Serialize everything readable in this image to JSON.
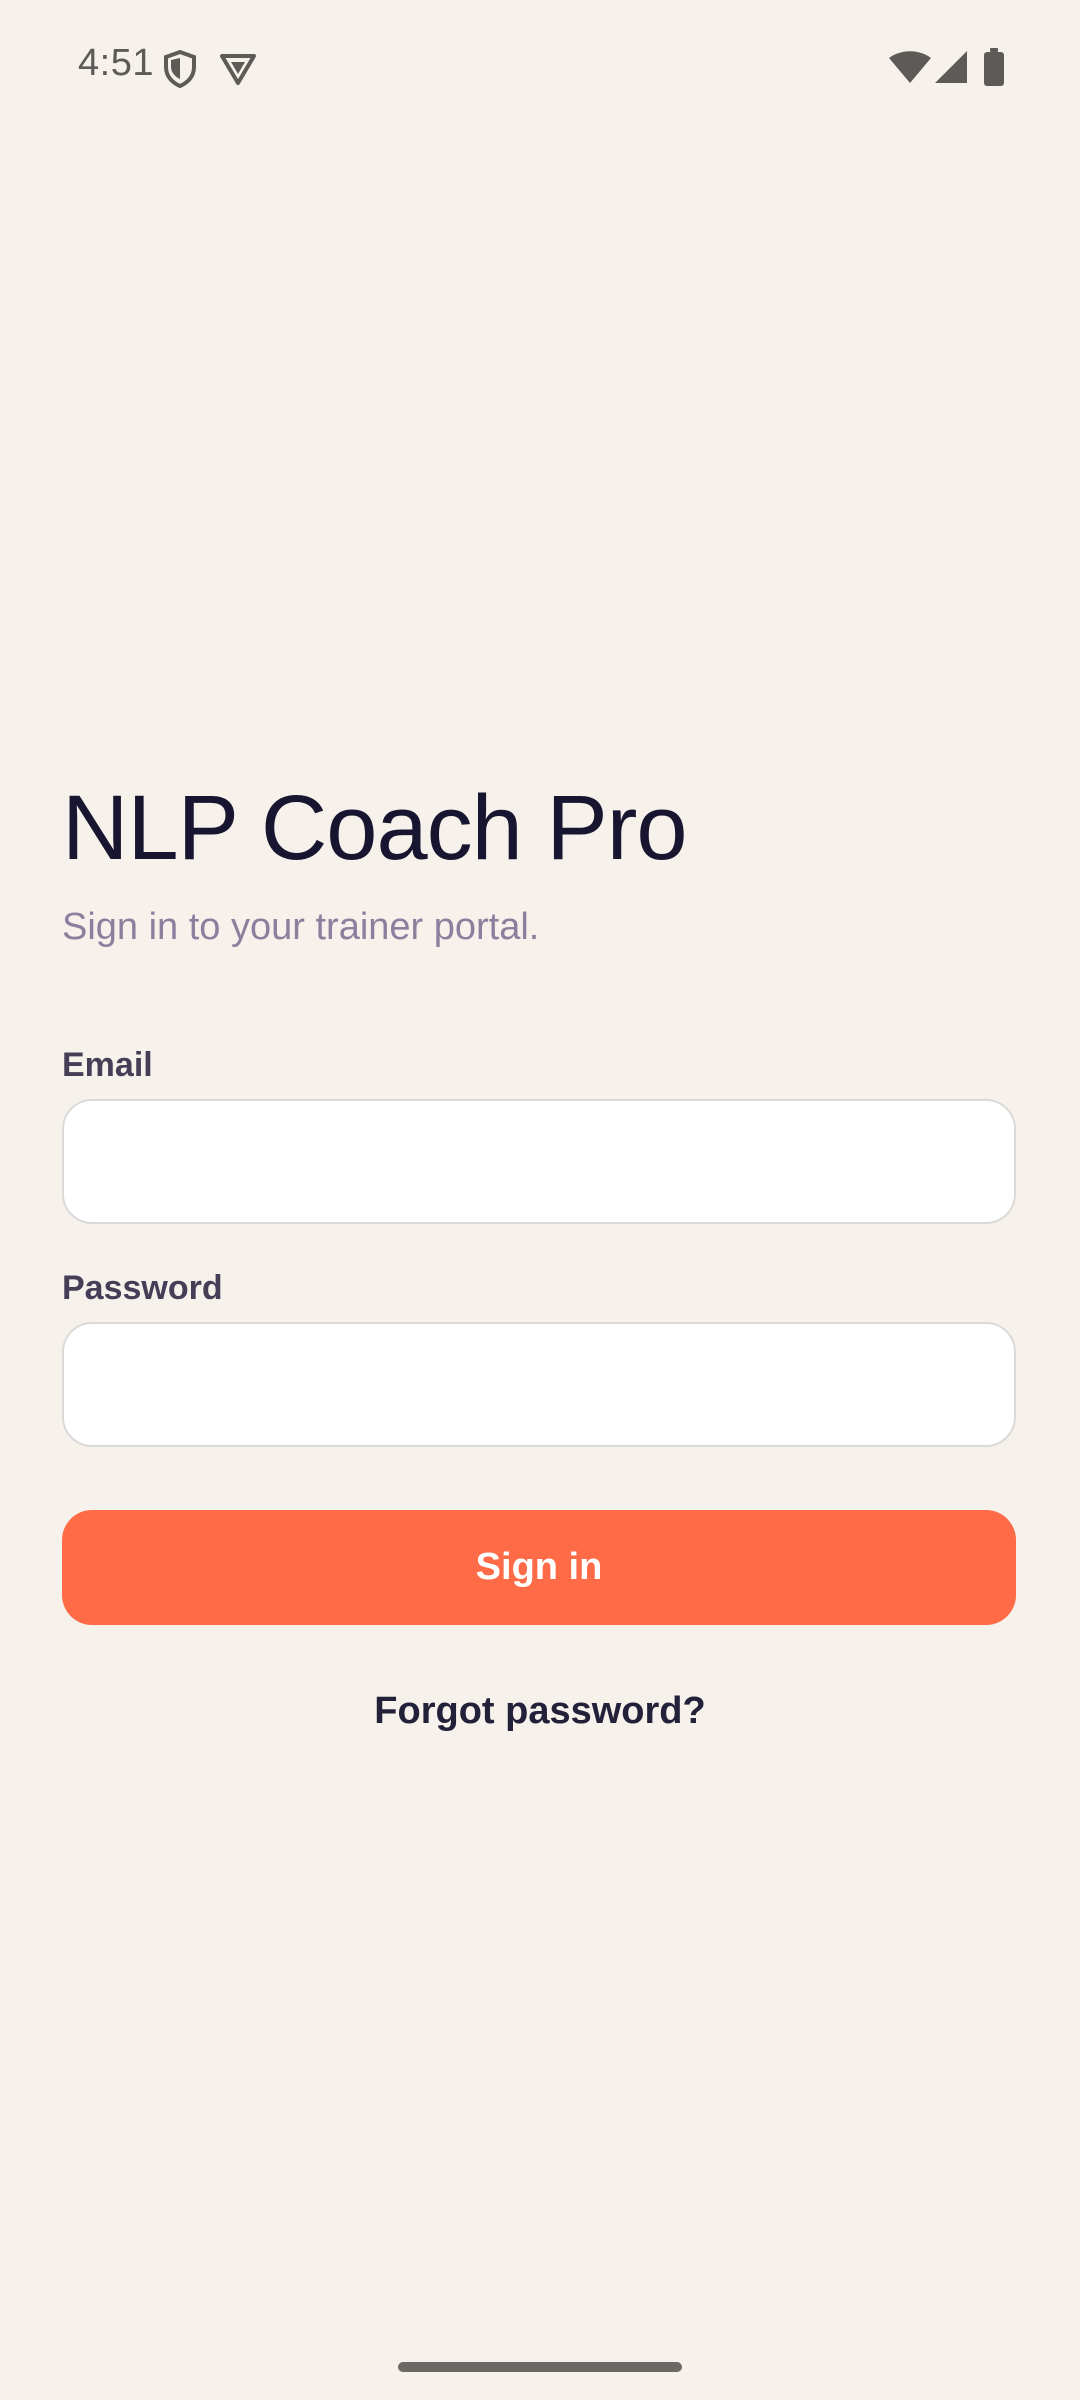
{
  "status_bar": {
    "time": "4:51",
    "icons": [
      "shield-icon",
      "vpn-badge-icon",
      "wifi-icon",
      "cellular-signal-icon",
      "battery-icon"
    ]
  },
  "header": {
    "title": "NLP Coach Pro",
    "subtitle": "Sign in to your trainer portal."
  },
  "form": {
    "email_label": "Email",
    "email_value": "",
    "password_label": "Password",
    "password_value": "",
    "submit_label": "Sign in",
    "forgot_label": "Forgot password?"
  },
  "colors": {
    "background": "#F6F1EB",
    "accent": "#FF6B47",
    "title": "#17152F",
    "subtitle": "#8A809E"
  }
}
